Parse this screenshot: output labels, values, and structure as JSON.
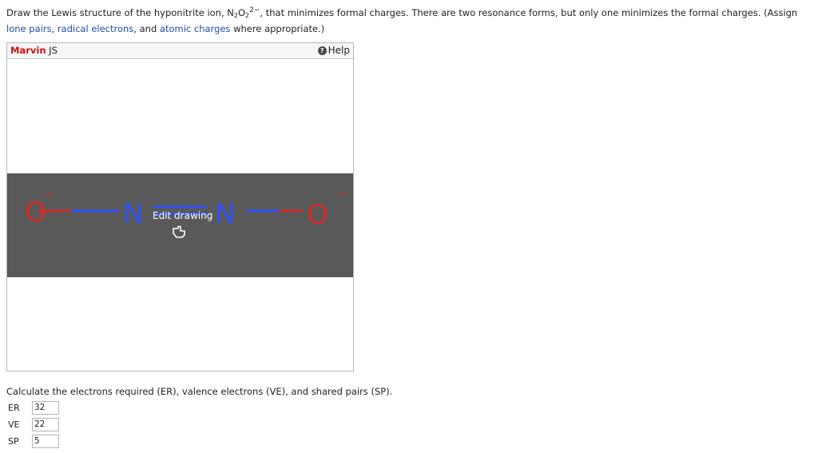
{
  "question": {
    "part1": "Draw the Lewis structure of the hyponitrite ion, N",
    "sub1": "2",
    "mid": "O",
    "sub2": "2",
    "sup": "2−",
    "part2": ", that minimizes formal charges. There are two resonance forms, but only one minimizes the formal charges. (Assign",
    "link_lone_pairs": "lone pairs",
    "sep1": ", ",
    "link_radical": "radical electrons",
    "sep2": ", and ",
    "link_atomic": "atomic charges",
    "part3": " where appropriate.)"
  },
  "marvin": {
    "brand_red": "Marvin",
    "brand_rest": " JS",
    "help_label": "Help",
    "edit_label": "Edit drawing"
  },
  "molecule": {
    "atoms": [
      {
        "symbol": "O",
        "charge": "−",
        "color": "#d12a2a"
      },
      {
        "symbol": "N",
        "charge": "",
        "color": "#3050f8"
      },
      {
        "symbol": "N",
        "charge": "",
        "color": "#3050f8"
      },
      {
        "symbol": "O",
        "charge": "−",
        "color": "#d12a2a"
      }
    ],
    "bonds": [
      "single",
      "double",
      "single"
    ]
  },
  "calc": {
    "prompt": "Calculate the electrons required (ER), valence electrons (VE), and shared pairs (SP).",
    "fields": [
      {
        "label": "ER",
        "value": "32"
      },
      {
        "label": "VE",
        "value": "22"
      },
      {
        "label": "SP",
        "value": "5"
      }
    ]
  },
  "colors": {
    "oxygen": "#d12a2a",
    "nitrogen": "#3050f8",
    "link": "#1a4fa8",
    "brand": "#cc1111",
    "overlay": "#595959"
  }
}
